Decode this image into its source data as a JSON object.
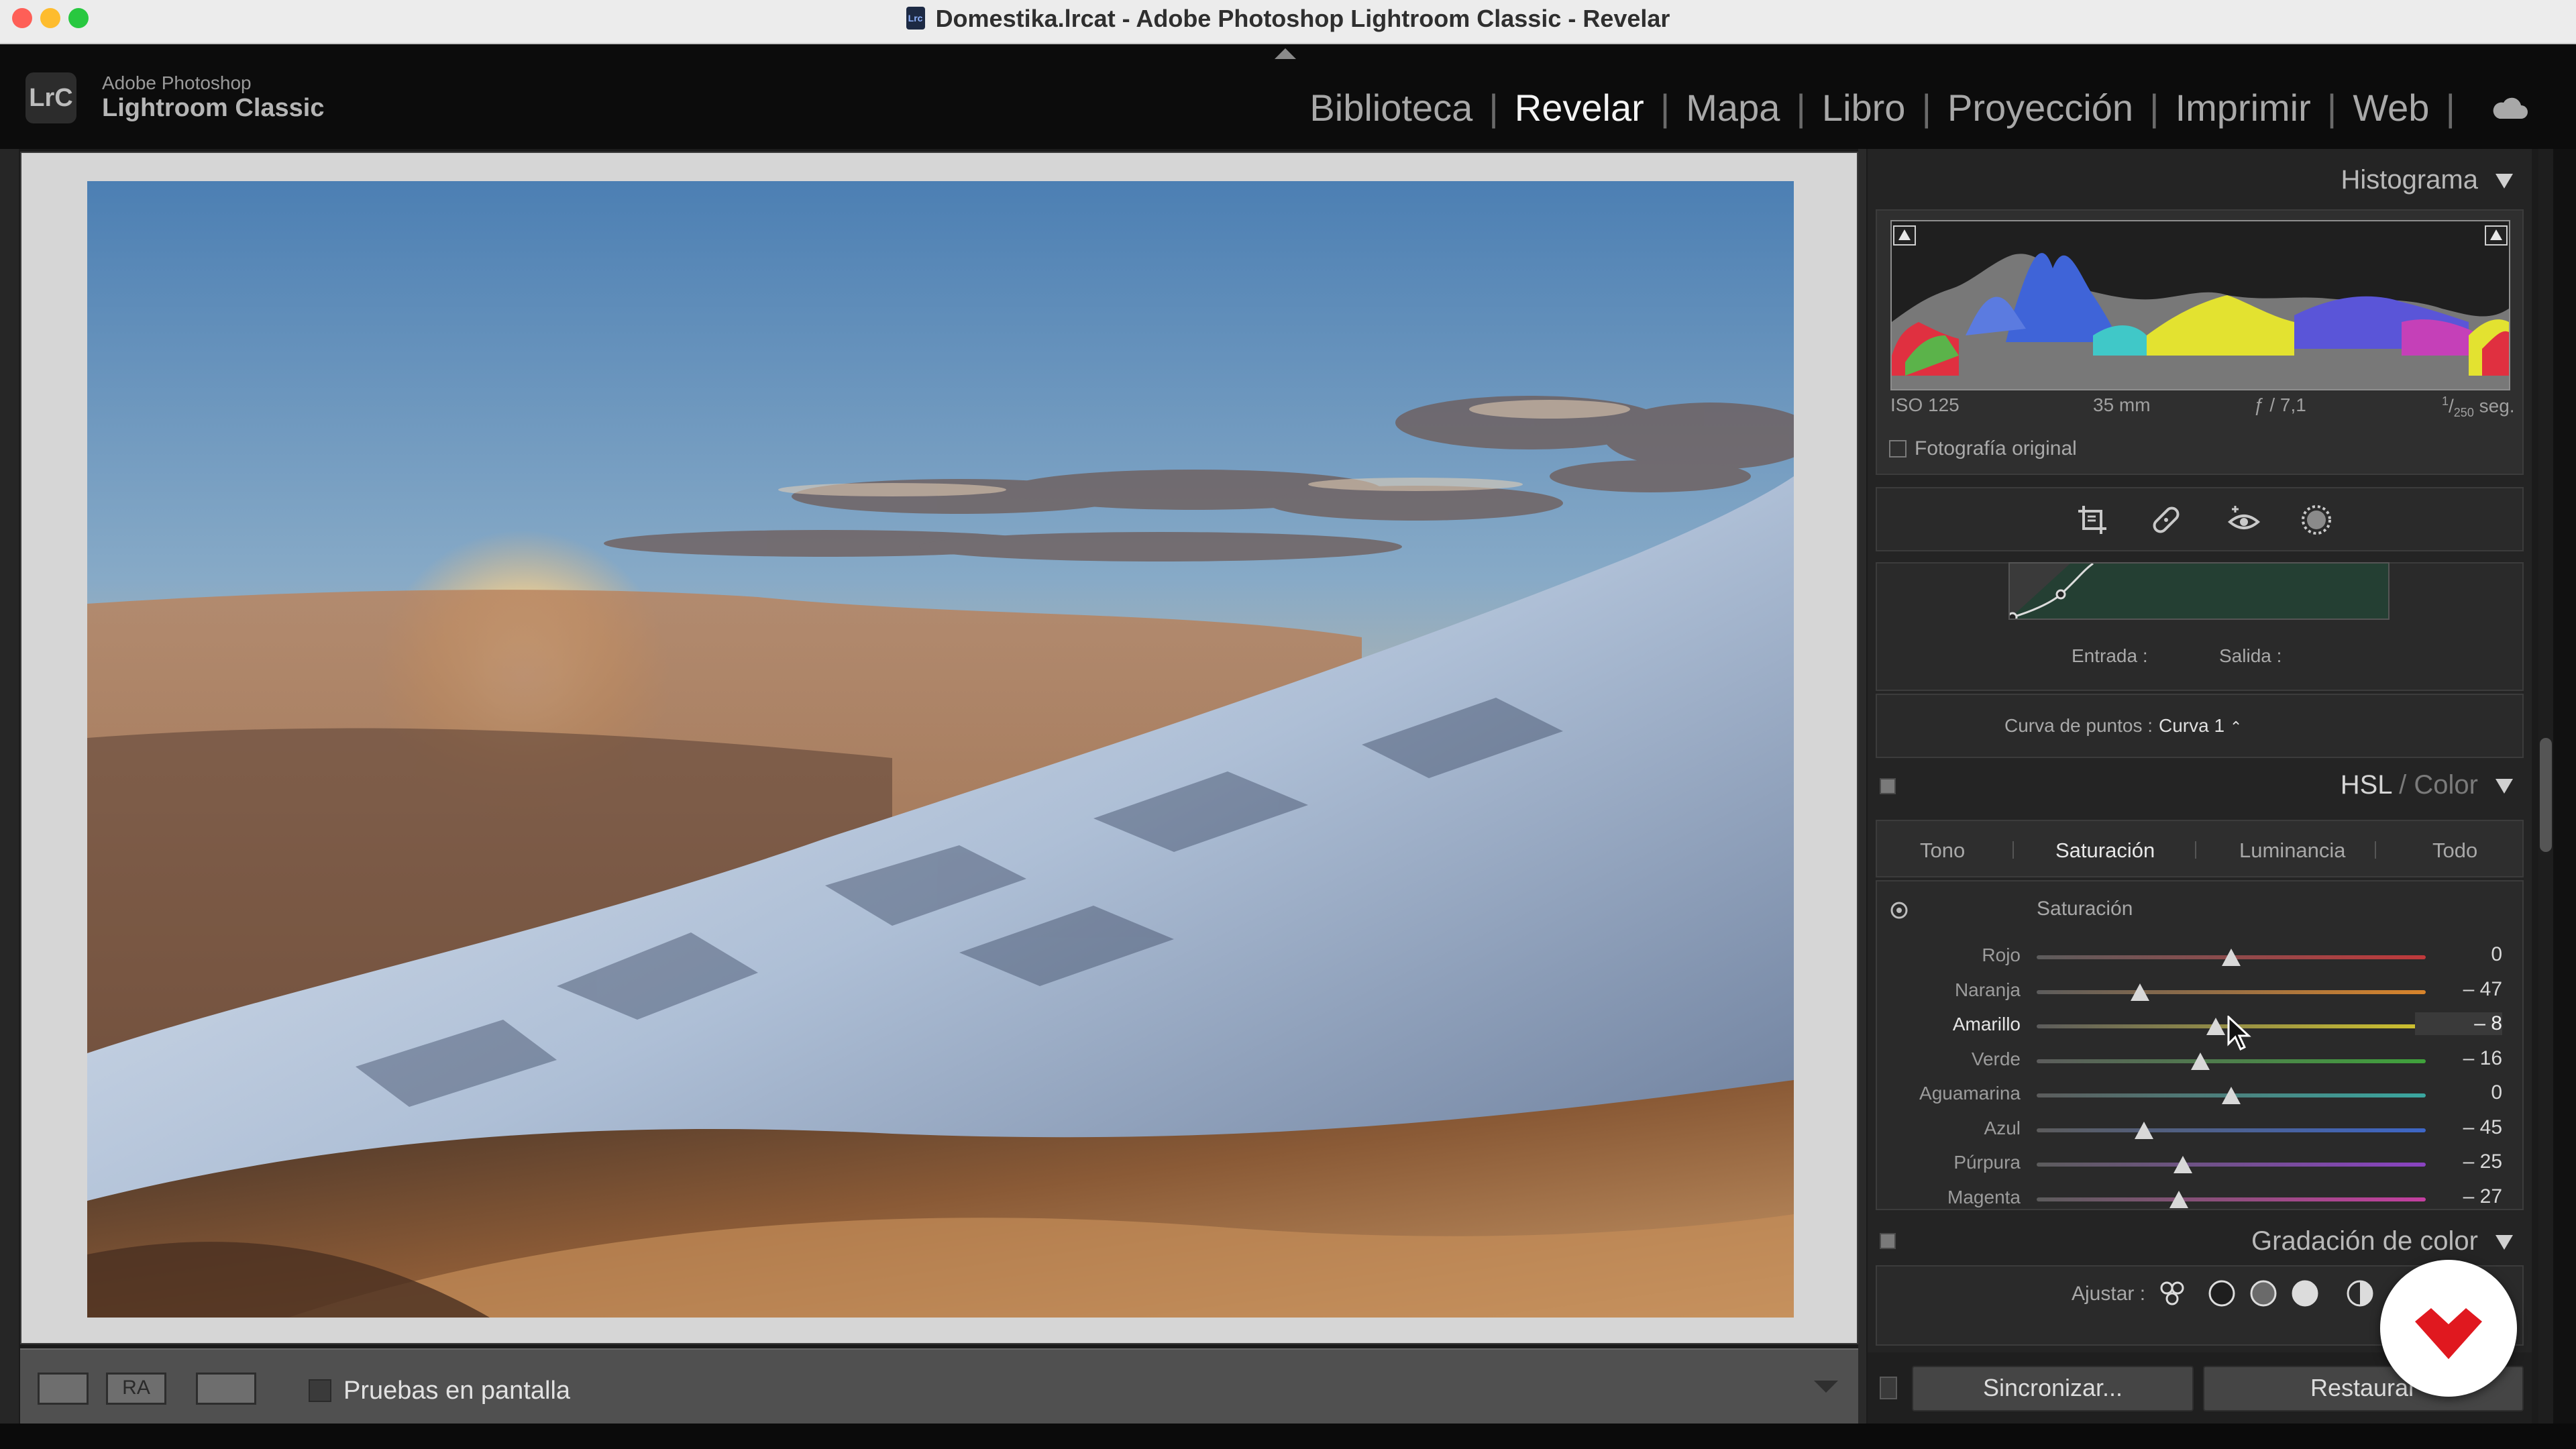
{
  "window": {
    "title": "Domestika.lrcat - Adobe Photoshop Lightroom Classic - Revelar",
    "doc_icon": "Lrc"
  },
  "brand": {
    "logo": "LrC",
    "line1": "Adobe Photoshop",
    "line2": "Lightroom Classic"
  },
  "modules": [
    "Biblioteca",
    "Revelar",
    "Mapa",
    "Libro",
    "Proyección",
    "Imprimir",
    "Web"
  ],
  "active_module": "Revelar",
  "toolbar": {
    "view_compare_label": "RA",
    "soft_proof_label": "Pruebas en pantalla"
  },
  "histogram": {
    "title": "Histograma",
    "iso": "ISO 125",
    "focal": "35 mm",
    "aperture": "ƒ / 7,1",
    "shutter_num": "1",
    "shutter_den": "250",
    "shutter_unit": "seg.",
    "original_label": "Fotografía original"
  },
  "tools": [
    "crop-overlay-icon",
    "spot-removal-icon",
    "red-eye-icon",
    "masking-icon"
  ],
  "tone_curve": {
    "entrada_label": "Entrada :",
    "salida_label": "Salida :",
    "curve_label": "Curva de puntos :",
    "curve_value": "Curva 1",
    "curve_arrows": "⌃"
  },
  "hsl": {
    "title_main": "HSL",
    "title_sep": " / ",
    "title_alt": "Color",
    "tabs": [
      "Tono",
      "Saturación",
      "Luminancia",
      "Todo"
    ],
    "active_tab": "Saturación",
    "section_title": "Saturación",
    "rows": [
      {
        "label": "Rojo",
        "display": "0",
        "value": 0,
        "color_end": "#c0393b"
      },
      {
        "label": "Naranja",
        "display": "– 47",
        "value": -47,
        "color_end": "#d8842b"
      },
      {
        "label": "Amarillo",
        "display": "– 8",
        "value": -8,
        "color_end": "#cfc22e"
      },
      {
        "label": "Verde",
        "display": "– 16",
        "value": -16,
        "color_end": "#3fa23b"
      },
      {
        "label": "Aguamarina",
        "display": "0",
        "value": 0,
        "color_end": "#3aa7a0"
      },
      {
        "label": "Azul",
        "display": "– 45",
        "value": -45,
        "color_end": "#3d66c7"
      },
      {
        "label": "Púrpura",
        "display": "– 25",
        "value": -25,
        "color_end": "#8a43c2"
      },
      {
        "label": "Magenta",
        "display": "– 27",
        "value": -27,
        "color_end": "#c43fa0"
      }
    ],
    "highlighted_row": "Amarillo"
  },
  "color_grading": {
    "title": "Gradación de color",
    "adjust_label": "Ajustar :"
  },
  "buttons": {
    "sync": "Sincronizar...",
    "reset": "Restaurar"
  },
  "colors": {
    "accent_active": "#f4f4f4",
    "brand_red": "#e0181f",
    "panel_bg": "#242424"
  }
}
